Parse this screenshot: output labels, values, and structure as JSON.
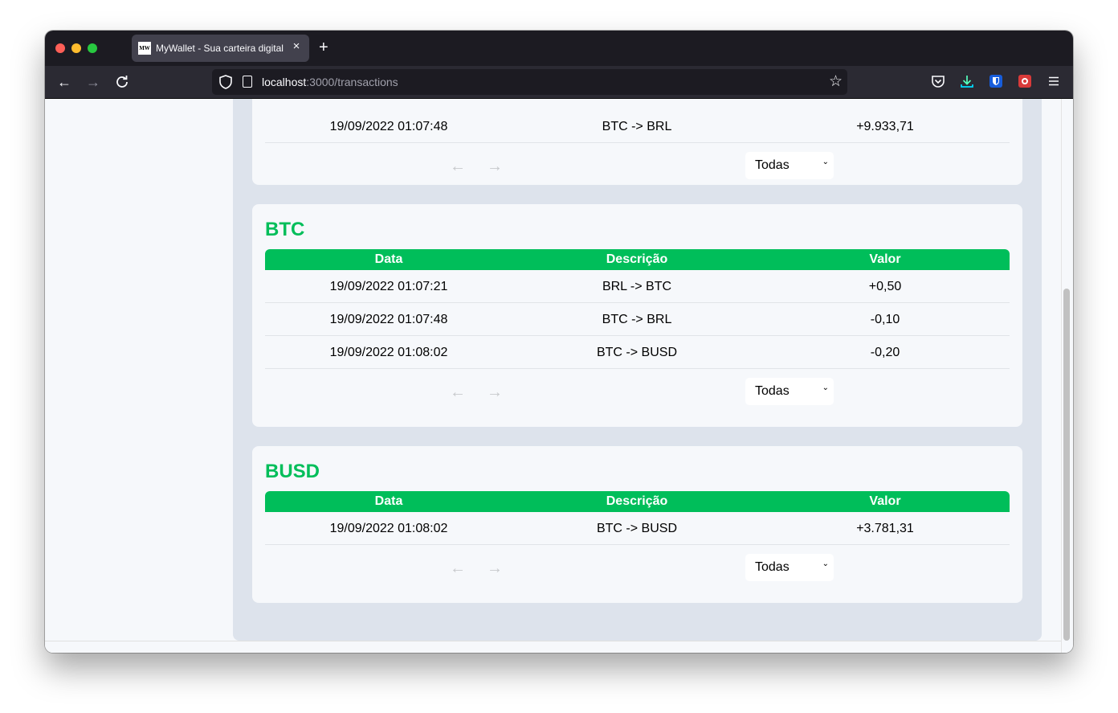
{
  "browser": {
    "tab_title": "MyWallet - Sua carteira digital",
    "tab_favicon": "MW",
    "url_host": "localhost",
    "url_path": ":3000/transactions",
    "icons": [
      "back-icon",
      "forward-icon",
      "reload-icon",
      "shield-icon",
      "page-icon",
      "star-icon",
      "pocket-icon",
      "download-icon",
      "bitwarden-icon",
      "extension-icon",
      "menu-icon"
    ]
  },
  "previous_card": {
    "rows": [
      {
        "data": "19/09/2022 01:07:48",
        "descricao": "BTC -> BRL",
        "valor": "+9.933,71"
      }
    ],
    "filter": "Todas"
  },
  "cards": [
    {
      "title": "BTC",
      "headers": {
        "data": "Data",
        "descricao": "Descrição",
        "valor": "Valor"
      },
      "rows": [
        {
          "data": "19/09/2022 01:07:21",
          "descricao": "BRL -> BTC",
          "valor": "+0,50"
        },
        {
          "data": "19/09/2022 01:07:48",
          "descricao": "BTC -> BRL",
          "valor": "-0,10"
        },
        {
          "data": "19/09/2022 01:08:02",
          "descricao": "BTC -> BUSD",
          "valor": "-0,20"
        }
      ],
      "filter": "Todas"
    },
    {
      "title": "BUSD",
      "headers": {
        "data": "Data",
        "descricao": "Descrição",
        "valor": "Valor"
      },
      "rows": [
        {
          "data": "19/09/2022 01:08:02",
          "descricao": "BTC -> BUSD",
          "valor": "+3.781,31"
        }
      ],
      "filter": "Todas"
    }
  ],
  "colors": {
    "accent": "#00be5a",
    "card_bg": "#f6f8fb",
    "main_bg": "#dde3ec"
  }
}
